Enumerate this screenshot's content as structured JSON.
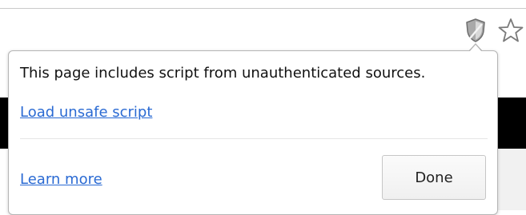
{
  "toolbar": {
    "shield_icon": "shield-warning-icon",
    "star_icon": "bookmark-star-icon"
  },
  "bubble": {
    "message": "This page includes script from unauthenticated sources.",
    "load_unsafe_label": "Load unsafe script",
    "learn_more_label": "Learn more",
    "done_label": "Done"
  },
  "colors": {
    "link": "#2a6ad3",
    "border": "#b5b5b5"
  }
}
